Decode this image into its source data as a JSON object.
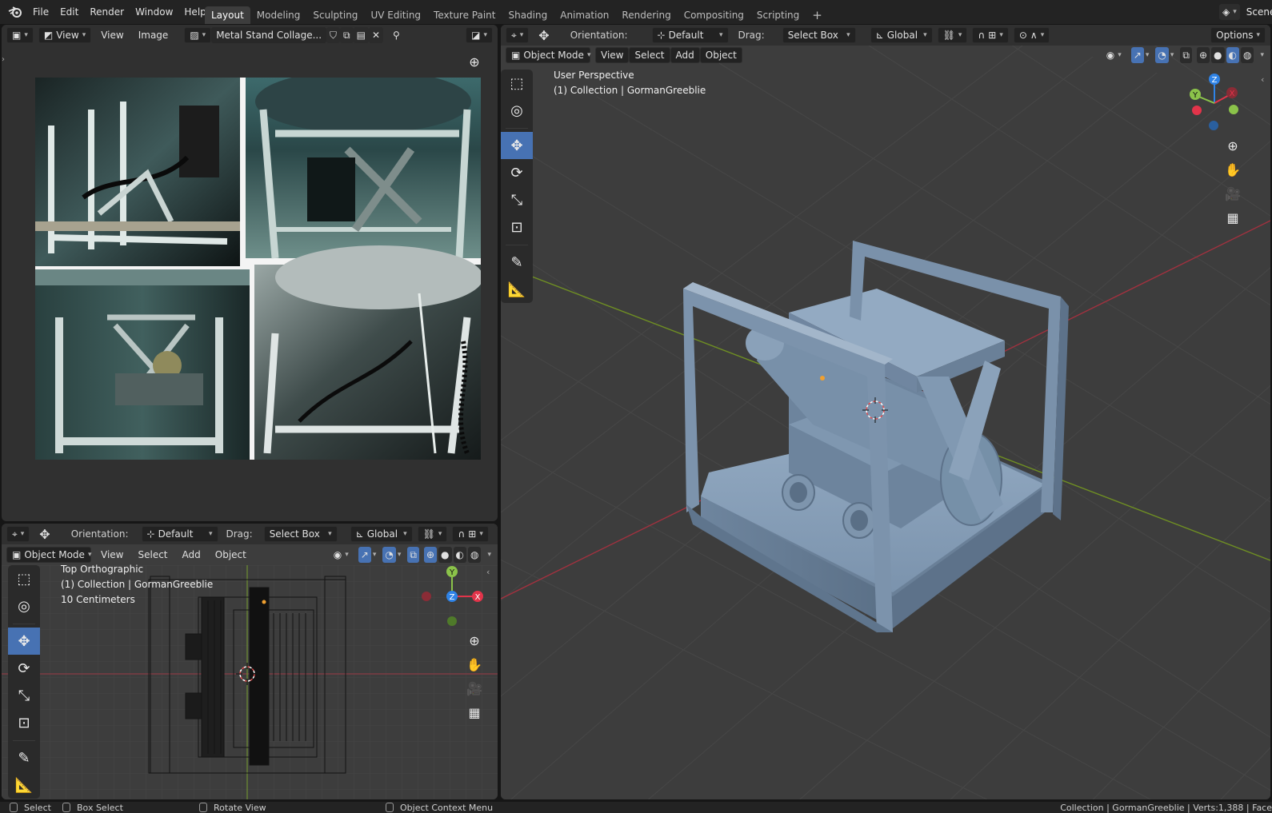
{
  "menubar": {
    "items": [
      "File",
      "Edit",
      "Render",
      "Window",
      "Help"
    ],
    "workspaces": [
      "Layout",
      "Modeling",
      "Sculpting",
      "UV Editing",
      "Texture Paint",
      "Shading",
      "Animation",
      "Rendering",
      "Compositing",
      "Scripting"
    ],
    "active_workspace": "Layout",
    "add_workspace": "+",
    "scene_label": "Scene"
  },
  "image_editor": {
    "view_mode": "View",
    "menus": [
      "View",
      "Image"
    ],
    "image_name": "Metal Stand Collage...",
    "icons": [
      "image-editor-type-icon",
      "fake-user-shield-icon",
      "new-image-icon",
      "open-image-icon",
      "unlink-close-icon",
      "pin-icon"
    ]
  },
  "viewport_header": {
    "orientation_label": "Orientation:",
    "orientation_value": "Default",
    "drag_label": "Drag:",
    "drag_value": "Select Box",
    "transform_space": "Global",
    "options_label": "Options"
  },
  "viewport_menus": {
    "mode": "Object Mode",
    "items": [
      "View",
      "Select",
      "Add",
      "Object"
    ]
  },
  "main_viewport": {
    "overlay_line1": "User Perspective",
    "overlay_line2": "(1) Collection | GormanGreeblie",
    "gizmo_axes": [
      "Z",
      "Y",
      "X"
    ]
  },
  "top_viewport": {
    "overlay_line1": "Top Orthographic",
    "overlay_line2": "(1) Collection | GormanGreeblie",
    "overlay_line3": "10 Centimeters",
    "gizmo_axes": [
      "Y",
      "Z",
      "X"
    ]
  },
  "status_bar": {
    "select": "Select",
    "box_select": "Box Select",
    "rotate_view": "Rotate View",
    "context_menu": "Object Context Menu",
    "stats": "Collection | GormanGreeblie | Verts:1,388 | Face"
  },
  "colors": {
    "accent": "#4772b3",
    "axis_x": "#e2344a",
    "axis_y": "#8bc34a",
    "axis_z": "#2f83e6",
    "viewport_bg": "#3d3d3d",
    "model": "#8097b0"
  }
}
